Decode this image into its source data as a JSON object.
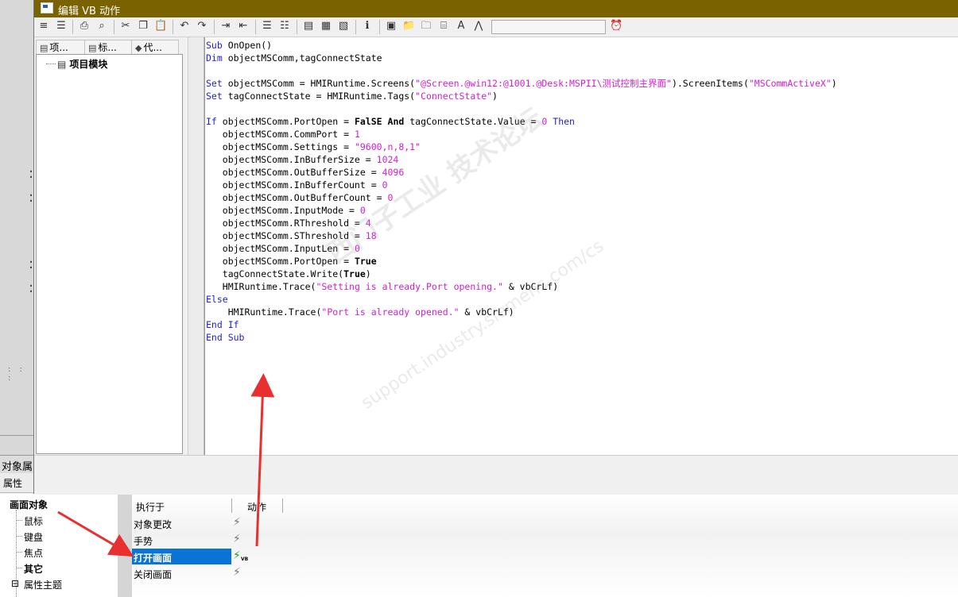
{
  "dialog": {
    "title": "编辑 VB 动作",
    "left_tabs": [
      "项...",
      "标...",
      "代..."
    ],
    "tree_root": "项目模块",
    "code_lines": [
      [
        {
          "t": "Sub",
          "c": "kw"
        },
        {
          "t": " OnOpen()",
          "c": ""
        }
      ],
      [
        {
          "t": "Dim",
          "c": "kw"
        },
        {
          "t": " objectMSComm,tagConnectState",
          "c": ""
        }
      ],
      [],
      [
        {
          "t": "Set",
          "c": "kw"
        },
        {
          "t": " objectMSComm = HMIRuntime.Screens(",
          "c": ""
        },
        {
          "t": "\"@Screen.@win12:@1001.@Desk:MSPII\\测试控制主界面\"",
          "c": "str"
        },
        {
          "t": ").ScreenItems(",
          "c": ""
        },
        {
          "t": "\"MSCommActiveX\"",
          "c": "str"
        },
        {
          "t": ")",
          "c": ""
        }
      ],
      [
        {
          "t": "Set",
          "c": "kw"
        },
        {
          "t": " tagConnectState = HMIRuntime.Tags(",
          "c": ""
        },
        {
          "t": "\"ConnectState\"",
          "c": "str"
        },
        {
          "t": ")",
          "c": ""
        }
      ],
      [],
      [
        {
          "t": "If",
          "c": "kw"
        },
        {
          "t": " objectMSComm.PortOpen = ",
          "c": ""
        },
        {
          "t": "FalSE",
          "c": "bold"
        },
        {
          "t": " ",
          "c": ""
        },
        {
          "t": "And",
          "c": "bold"
        },
        {
          "t": " tagConnectState.Value = ",
          "c": ""
        },
        {
          "t": "0",
          "c": "num"
        },
        {
          "t": " ",
          "c": ""
        },
        {
          "t": "Then",
          "c": "kw"
        }
      ],
      [
        {
          "t": "   objectMSComm.CommPort = ",
          "c": ""
        },
        {
          "t": "1",
          "c": "num"
        }
      ],
      [
        {
          "t": "   objectMSComm.Settings = ",
          "c": ""
        },
        {
          "t": "\"9600,n,8,1\"",
          "c": "str"
        }
      ],
      [
        {
          "t": "   objectMSComm.InBufferSize = ",
          "c": ""
        },
        {
          "t": "1024",
          "c": "num"
        }
      ],
      [
        {
          "t": "   objectMSComm.OutBufferSize = ",
          "c": ""
        },
        {
          "t": "4096",
          "c": "num"
        }
      ],
      [
        {
          "t": "   objectMSComm.InBufferCount = ",
          "c": ""
        },
        {
          "t": "0",
          "c": "num"
        }
      ],
      [
        {
          "t": "   objectMSComm.OutBufferCount = ",
          "c": ""
        },
        {
          "t": "0",
          "c": "num"
        }
      ],
      [
        {
          "t": "   objectMSComm.InputMode = ",
          "c": ""
        },
        {
          "t": "0",
          "c": "num"
        }
      ],
      [
        {
          "t": "   objectMSComm.RThreshold = ",
          "c": ""
        },
        {
          "t": "4",
          "c": "num"
        }
      ],
      [
        {
          "t": "   objectMSComm.SThreshold = ",
          "c": ""
        },
        {
          "t": "18",
          "c": "num"
        }
      ],
      [
        {
          "t": "   objectMSComm.InputLen = ",
          "c": ""
        },
        {
          "t": "0",
          "c": "num"
        }
      ],
      [
        {
          "t": "   objectMSComm.PortOpen = ",
          "c": ""
        },
        {
          "t": "True",
          "c": "bold"
        }
      ],
      [
        {
          "t": "   tagConnectState.Write(",
          "c": ""
        },
        {
          "t": "True",
          "c": "bold"
        },
        {
          "t": ")",
          "c": ""
        }
      ],
      [
        {
          "t": "   HMIRuntime.Trace(",
          "c": ""
        },
        {
          "t": "\"Setting is already.Port opening.\"",
          "c": "str"
        },
        {
          "t": " & vbCrLf)",
          "c": ""
        }
      ],
      [
        {
          "t": "Else",
          "c": "kw"
        }
      ],
      [
        {
          "t": "    HMIRuntime.Trace(",
          "c": ""
        },
        {
          "t": "\"Port is already opened.\"",
          "c": "str"
        },
        {
          "t": " & vbCrLf)",
          "c": ""
        }
      ],
      [
        {
          "t": "End If",
          "c": "kw"
        }
      ],
      [
        {
          "t": "End Sub",
          "c": "kw"
        }
      ]
    ]
  },
  "background": {
    "props_title": "对象属",
    "props_tab": "属性",
    "tree": {
      "root": "画面对象",
      "items": [
        "鼠标",
        "键盘",
        "焦点",
        "其它"
      ],
      "theme": "属性主题"
    },
    "events": {
      "col_exec": "执行于",
      "col_action": "动作",
      "rows": [
        "对象更改",
        "手势",
        "打开画面",
        "关闭画面"
      ],
      "selected_index": 2,
      "vb_badge": "VB"
    }
  },
  "watermark": {
    "line1": "西门子工业 技术论坛",
    "line2": "support.industry.siemens.com/cs"
  },
  "colors": {
    "titlebar": "#7a6200",
    "keyword": "#1f1fcf",
    "string": "#d01ed0",
    "selection": "#0a74d6",
    "arrow": "#e83030"
  }
}
